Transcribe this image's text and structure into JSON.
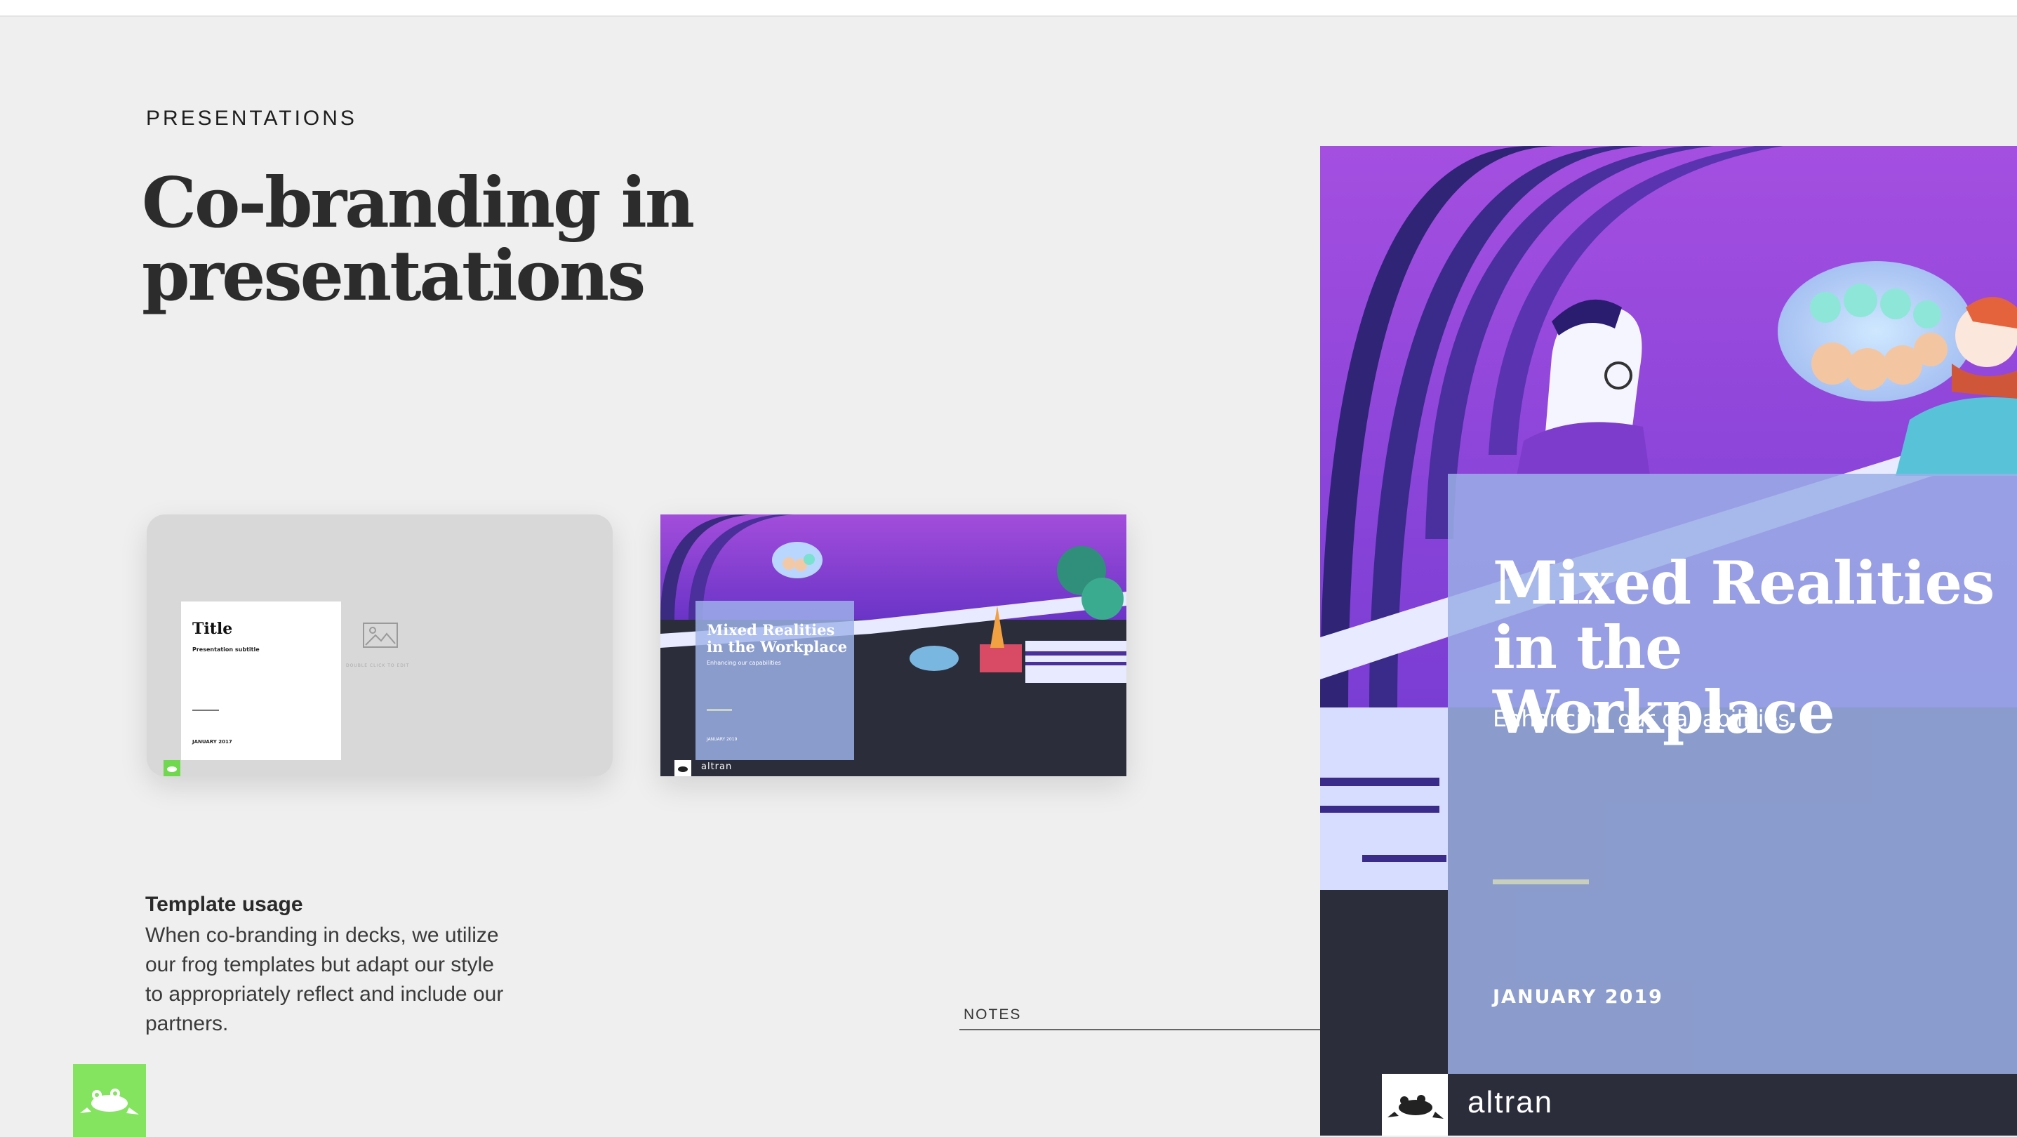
{
  "section": {
    "eyebrow": "PRESENTATIONS",
    "title_line1": "Co-branding in",
    "title_line2": "presentations"
  },
  "template_slide": {
    "title": "Title",
    "subtitle": "Presentation subtitle",
    "date": "JANUARY 2017",
    "image_hint": "DOUBLE CLICK TO EDIT"
  },
  "cobrand_slide": {
    "heading_line1": "Mixed Realities",
    "heading_line2": "in the Workplace",
    "subtitle": "Enhancing our capabilities",
    "date": "JANUARY 2019",
    "partner": "altran"
  },
  "usage": {
    "heading": "Template usage",
    "body": "When co-branding in decks, we utilize our frog templates but adapt our style to appropriately reflect and include our partners."
  },
  "notes_label": "NOTES",
  "colors": {
    "frog_green": "#84e35f",
    "purple": "#7b3fd1",
    "panel": "#9bafe6",
    "dark": "#2b2d3b"
  },
  "icons": [
    "image-placeholder-icon",
    "frog-logo-icon",
    "altran-logo"
  ]
}
